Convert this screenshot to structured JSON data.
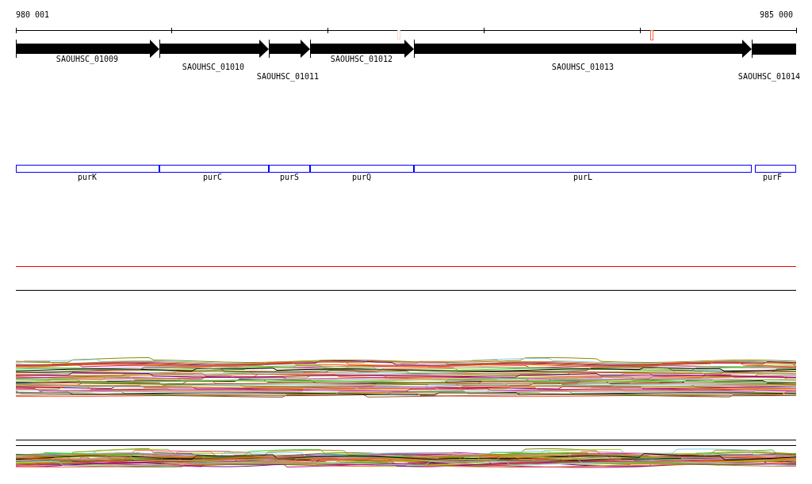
{
  "ruler": {
    "start_label": "980 001",
    "end_label": "985 000"
  },
  "genes": [
    {
      "label": "SAOUHSC_01009"
    },
    {
      "label": "SAOUHSC_01010"
    },
    {
      "label": "SAOUHSC_01011"
    },
    {
      "label": "SAOUHSC_01012"
    },
    {
      "label": "SAOUHSC_01013"
    },
    {
      "label": "SAOUHSC_01014"
    }
  ],
  "operons": [
    {
      "label": "purK"
    },
    {
      "label": "purC"
    },
    {
      "label": "purS"
    },
    {
      "label": "purQ"
    },
    {
      "label": "purL"
    },
    {
      "label": "purF"
    }
  ]
}
